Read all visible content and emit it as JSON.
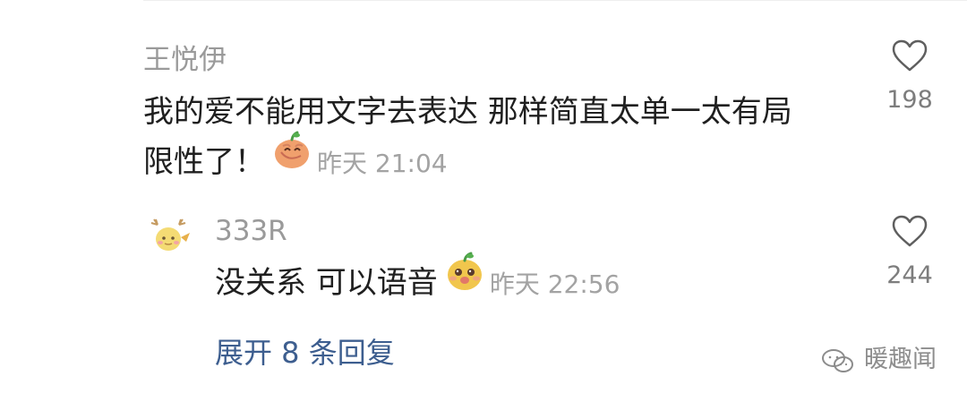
{
  "comment": {
    "username": "王悦伊",
    "line1": "我的爱不能用文字去表达 那样简直太单一太有局",
    "line2": "限性了！",
    "time": "昨天 21:04",
    "like_count": "198",
    "emoji_icon": "shy-mango-emoji"
  },
  "reply": {
    "username": "333R",
    "text": "没关系 可以语音",
    "time": "昨天 22:56",
    "like_count": "244",
    "emoji_icon": "smiling-mango-emoji"
  },
  "expand_replies_label": "展开 8 条回复",
  "watermark": {
    "text": "暖趣闻",
    "icon": "wechat-icon"
  }
}
